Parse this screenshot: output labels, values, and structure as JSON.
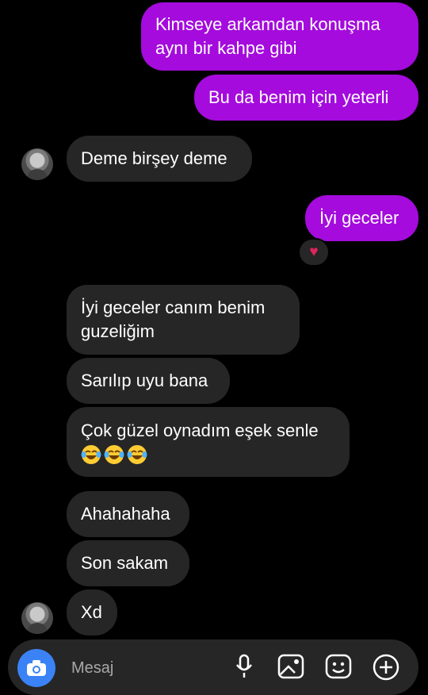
{
  "messages": [
    {
      "id": "m1",
      "direction": "outgoing",
      "lines": [
        "Kimseye arkamdan konuşma",
        "aynı bir kahpe gibi"
      ]
    },
    {
      "id": "m2",
      "direction": "outgoing",
      "lines": [
        "Bu da benim için yeterli"
      ]
    },
    {
      "id": "m3",
      "direction": "incoming",
      "lines": [
        "Deme birşey deme"
      ]
    },
    {
      "id": "m4",
      "direction": "outgoing",
      "lines": [
        "İyi geceler"
      ],
      "reaction": "♥"
    },
    {
      "id": "m5",
      "direction": "incoming",
      "lines": [
        "İyi geceler canım benim",
        "guzeliğim"
      ]
    },
    {
      "id": "m6",
      "direction": "incoming",
      "lines": [
        "Sarılıp uyu bana"
      ]
    },
    {
      "id": "m7",
      "direction": "incoming",
      "lines": [
        "Çok güzel oynadım eşek senle"
      ],
      "emoji": "face-with-tears-of-joy",
      "emoji_count": 3
    },
    {
      "id": "m8",
      "direction": "incoming",
      "lines": [
        "Ahahahaha"
      ]
    },
    {
      "id": "m9",
      "direction": "incoming",
      "lines": [
        "Son sakam"
      ]
    },
    {
      "id": "m10",
      "direction": "incoming",
      "lines": [
        "Xd"
      ]
    }
  ],
  "composer": {
    "placeholder": "Mesaj",
    "icons": [
      "camera-icon",
      "microphone-icon",
      "gallery-icon",
      "sticker-icon",
      "plus-icon"
    ]
  },
  "colors": {
    "outgoing_bubble": "#a40bdc",
    "incoming_bubble": "#262626",
    "background": "#000000",
    "camera_button": "#3b82f6",
    "reaction": "#e0245e"
  }
}
